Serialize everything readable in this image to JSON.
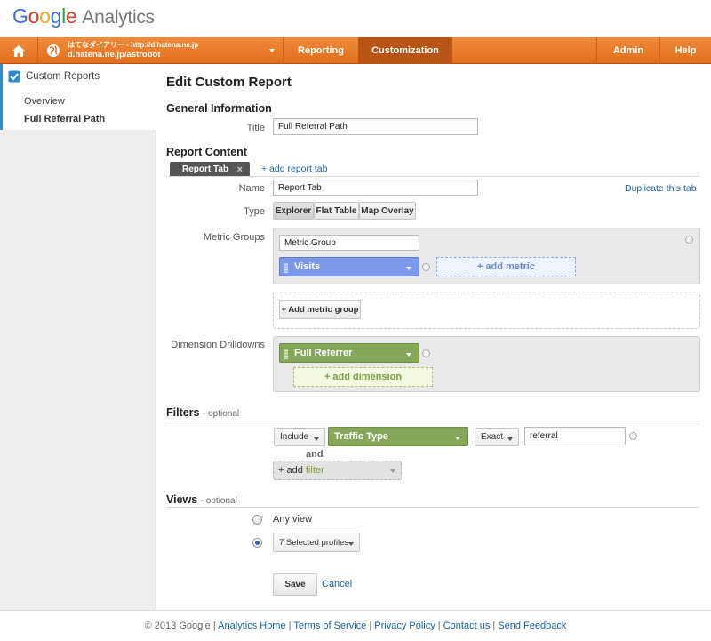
{
  "logo": {
    "google": [
      "G",
      "o",
      "o",
      "g",
      "l",
      "e"
    ],
    "product": "Analytics"
  },
  "nav": {
    "account_line1": "はてなダイアリー - http://d.hatena.ne.jp",
    "account_line2": "d.hatena.ne.jp/astrobot",
    "items": [
      {
        "label": "Reporting",
        "active": false
      },
      {
        "label": "Customization",
        "active": true
      },
      {
        "label": "Admin",
        "active": false
      },
      {
        "label": "Help",
        "active": false
      }
    ]
  },
  "sidebar": {
    "title": "Custom Reports",
    "items": [
      {
        "label": "Overview"
      },
      {
        "label": "Full Referral Path",
        "selected": true
      }
    ]
  },
  "main": {
    "heading": "Edit Custom Report",
    "general": {
      "heading": "General Information",
      "title_label": "Title",
      "title_value": "Full Referral Path"
    },
    "content": {
      "heading": "Report Content",
      "tab_label": "Report Tab",
      "tab_close": "×",
      "add_tab": "+ add report tab",
      "name_label": "Name",
      "name_value": "Report Tab",
      "duplicate": "Duplicate this tab",
      "type_label": "Type",
      "types": [
        "Explorer",
        "Flat Table",
        "Map Overlay"
      ],
      "metric_groups_label": "Metric Groups",
      "metric_group_name": "Metric Group",
      "metric": "Visits",
      "add_metric": "+ add metric",
      "add_metric_group": "+ Add metric group",
      "dimension_label": "Dimension Drilldowns",
      "dimension": "Full Referrer",
      "add_dimension": "+ add dimension"
    },
    "filters": {
      "heading": "Filters",
      "optional": "- optional",
      "include": "Include",
      "dimension": "Traffic Type",
      "match": "Exact",
      "value": "referral",
      "and": "and",
      "add_filter_prefix": "+ add ",
      "add_filter_word": "filter"
    },
    "views": {
      "heading": "Views",
      "optional": "- optional",
      "any_view": "Any view",
      "selected_profiles": "7 Selected profiles"
    },
    "save": "Save",
    "cancel": "Cancel"
  },
  "footer": {
    "copyright": "© 2013 Google",
    "links": [
      "Analytics Home",
      "Terms of Service",
      "Privacy Policy",
      "Contact us",
      "Send Feedback"
    ],
    "separator": " | "
  },
  "colors": {
    "nav_orange": "#e8791f",
    "nav_active": "#b75416",
    "metric_blue": "#7b99e8",
    "dimension_green": "#86a75a",
    "link_blue": "#1b5fa8"
  }
}
